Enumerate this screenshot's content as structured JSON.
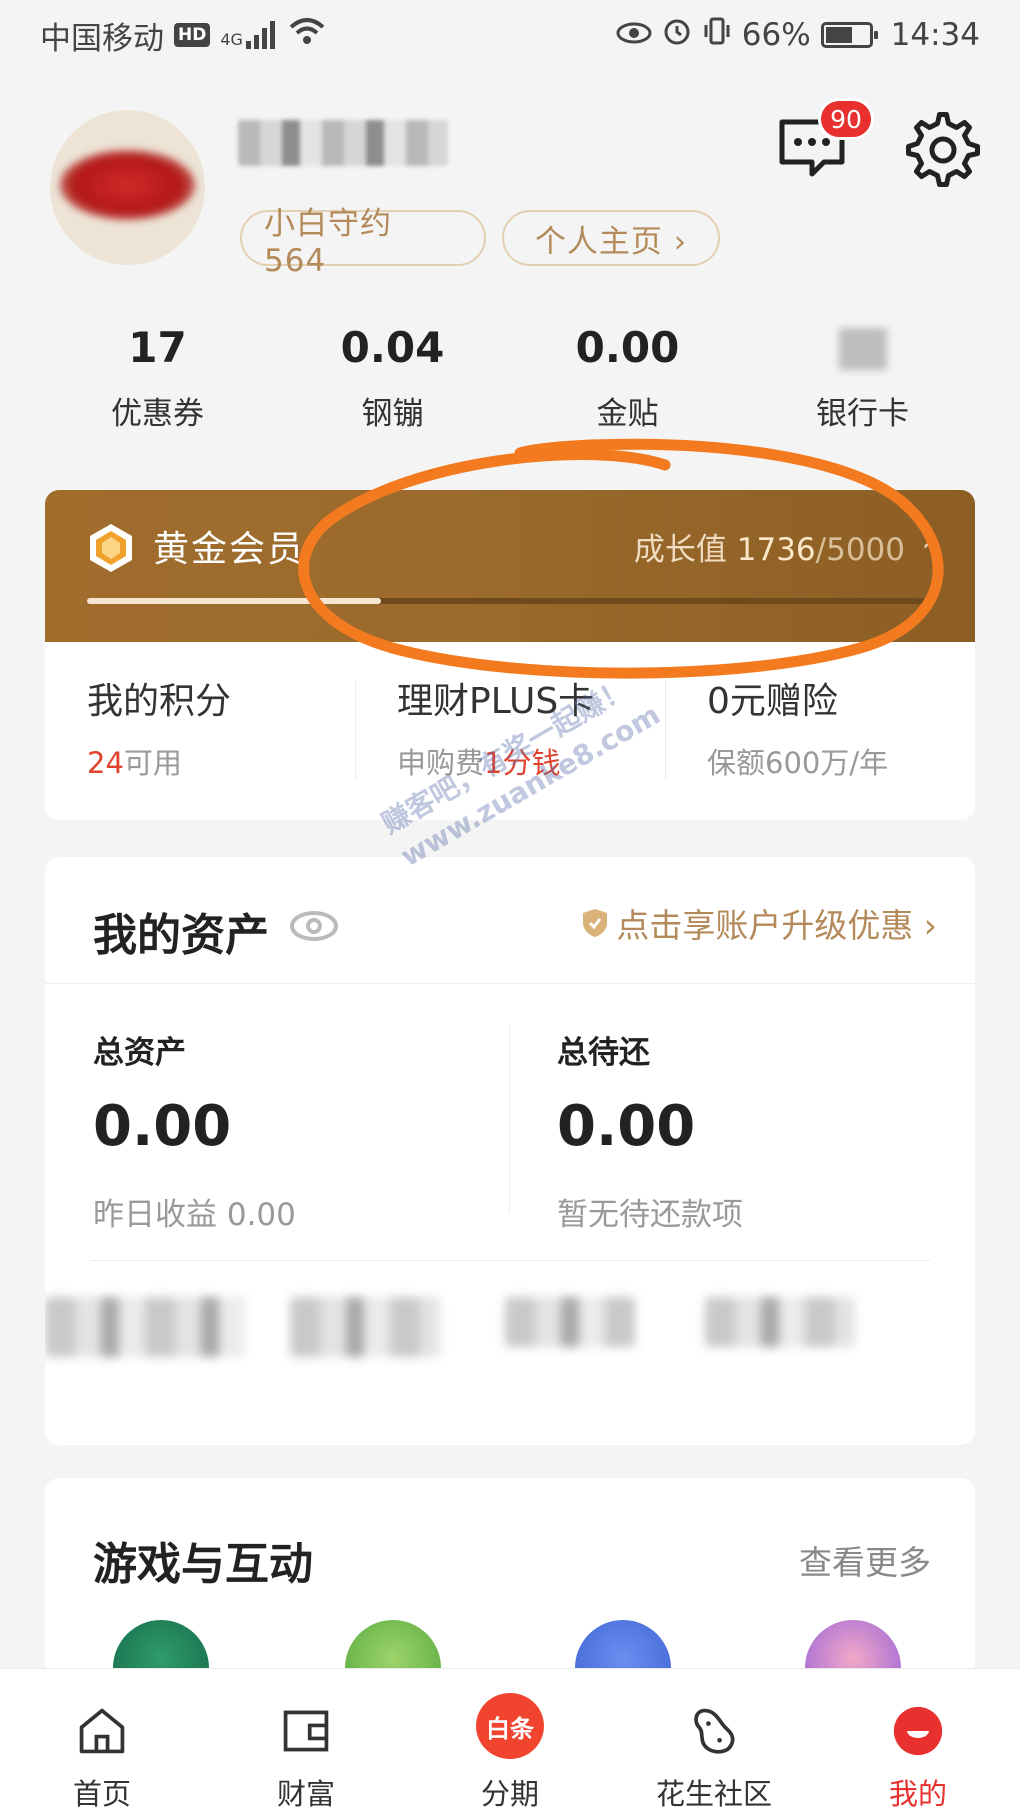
{
  "status_bar": {
    "carrier": "中国移动",
    "hd": "HD",
    "network": "4G",
    "battery": "66%",
    "battery_level": 0.66,
    "time": "14:34"
  },
  "header": {
    "chip_xiaobai": "小白守约 564",
    "chip_profile": "个人主页 ›",
    "message_badge": "90"
  },
  "stats": [
    {
      "value": "17",
      "label": "优惠券"
    },
    {
      "value": "0.04",
      "label": "钢镚"
    },
    {
      "value": "0.00",
      "label": "金贴"
    },
    {
      "value": "",
      "label": "银行卡"
    }
  ],
  "membership": {
    "level": "黄金会员",
    "growth_label": "成长值",
    "growth_current": "1736",
    "growth_max": "/5000",
    "progress": 0.347,
    "perks": [
      {
        "title": "我的积分",
        "sub_highlight": "24",
        "sub_pre": "",
        "sub_post": "可用"
      },
      {
        "title": "理财PLUS卡",
        "sub_pre": "申购费",
        "sub_highlight": "1分钱",
        "sub_post": ""
      },
      {
        "title": "0元赠险",
        "sub_pre": "保额600万/年",
        "sub_highlight": "",
        "sub_post": ""
      }
    ]
  },
  "assets": {
    "title": "我的资产",
    "upgrade": "点击享账户升级优惠 ›",
    "total_assets_label": "总资产",
    "total_assets_value": "0.00",
    "yesterday_label": "昨日收益 0.00",
    "total_due_label": "总待还",
    "total_due_value": "0.00",
    "due_sub": "暂无待还款项"
  },
  "games": {
    "title": "游戏与互动",
    "more": "查看更多"
  },
  "watermark": {
    "line1": "赚客吧，有奖一起赚！",
    "line2": "www.zuanke8.com"
  },
  "nav": [
    {
      "label": "首页"
    },
    {
      "label": "财富"
    },
    {
      "label": "分期",
      "icon_text": "白条"
    },
    {
      "label": "花生社区"
    },
    {
      "label": "我的"
    }
  ],
  "colors": {
    "accent_red": "#e8312f",
    "gold": "#b48a5a",
    "member_brown": "#9b6a2c",
    "annotation_orange": "#f47a20"
  }
}
